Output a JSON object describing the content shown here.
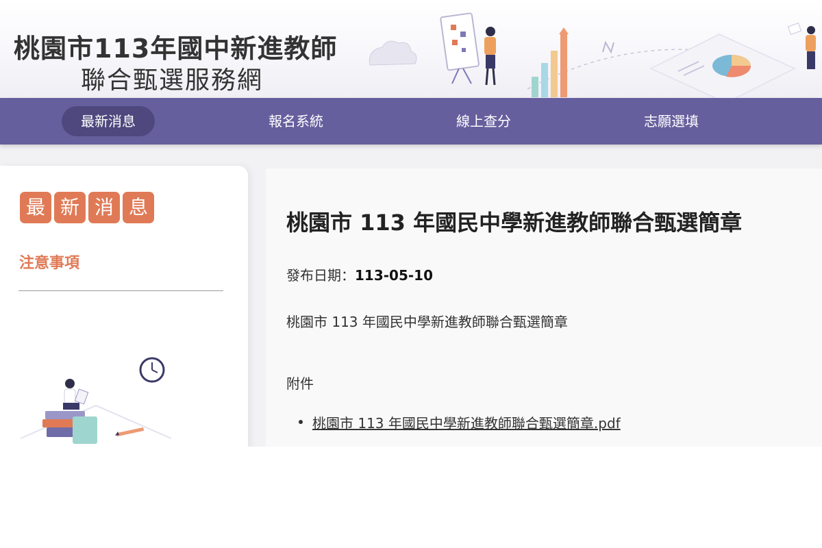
{
  "header": {
    "title_line1": "桃園市113年國中新進教師",
    "title_line2": "聯合甄選服務網"
  },
  "nav": {
    "items": [
      {
        "label": "最新消息",
        "active": true
      },
      {
        "label": "報名系統",
        "active": false
      },
      {
        "label": "線上查分",
        "active": false
      },
      {
        "label": "志願選填",
        "active": false
      }
    ]
  },
  "sidebar": {
    "heading_tiles": [
      "最",
      "新",
      "消",
      "息"
    ],
    "link": "注意事項"
  },
  "article": {
    "title": "桃園市 113 年國民中學新進教師聯合甄選簡章",
    "date_label": "發布日期：",
    "date_value": "113-05-10",
    "summary": "桃園市 113 年國民中學新進教師聯合甄選簡章",
    "attachments_label": "附件",
    "attachments": [
      "桃園市 113 年國民中學新進教師聯合甄選簡章.pdf"
    ]
  },
  "colors": {
    "nav_bg": "#655f9e",
    "nav_active": "#4e487e",
    "accent_orange": "#e07a56"
  },
  "icons": [
    "clock-icon",
    "presentation-board-icon",
    "pie-chart-icon",
    "bar-chart-icon",
    "cloud-icon",
    "pencil-icon"
  ]
}
